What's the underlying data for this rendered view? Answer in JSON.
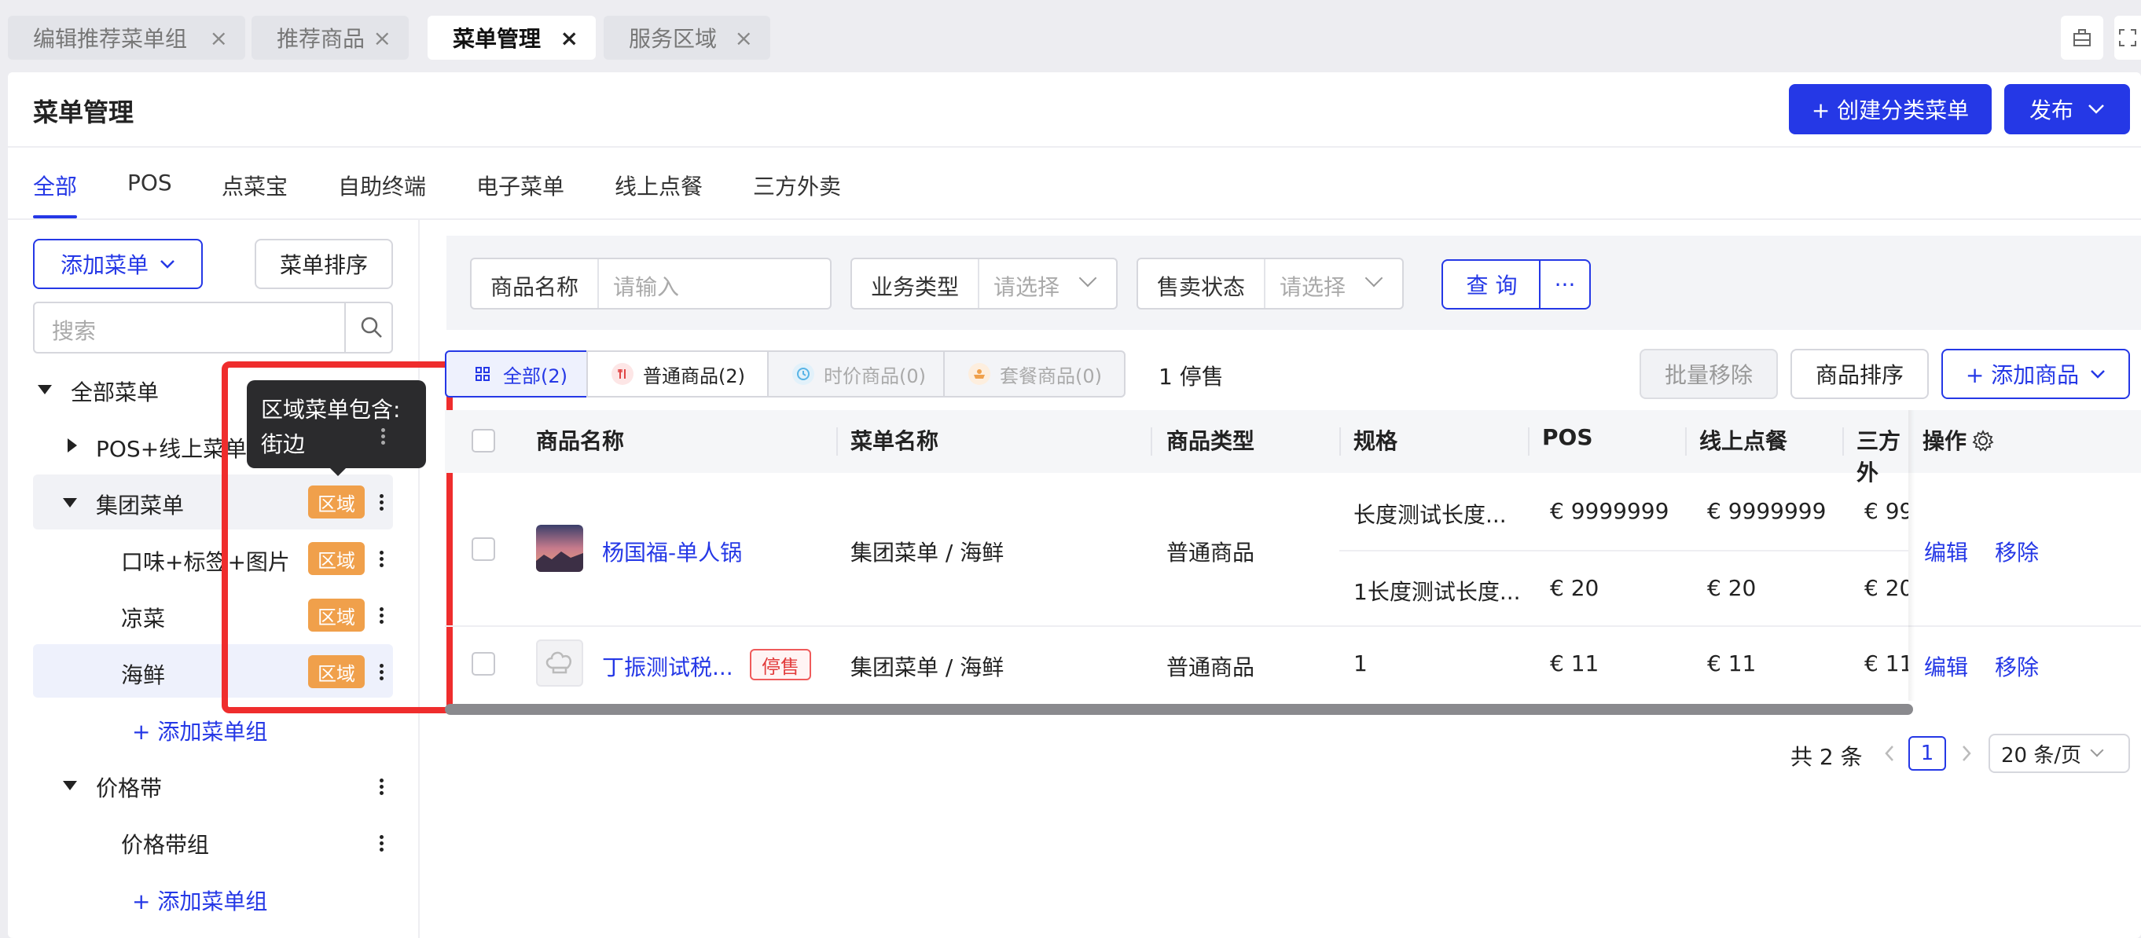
{
  "tabs": [
    {
      "label": "编辑推荐菜单组",
      "close": "×"
    },
    {
      "label": "推荐商品",
      "close": "×"
    },
    {
      "label": "菜单管理",
      "close": "×"
    },
    {
      "label": "服务区域",
      "close": "×"
    }
  ],
  "header": {
    "title": "菜单管理",
    "create_label": "+ 创建分类菜单",
    "publish_label": "发布"
  },
  "channels": [
    "全部",
    "POS",
    "点菜宝",
    "自助终端",
    "电子菜单",
    "线上点餐",
    "三方外卖"
  ],
  "sidebar": {
    "add_menu_label": "添加菜单",
    "sort_label": "菜单排序",
    "search_placeholder": "搜索",
    "tree": {
      "all_menus": "全部菜单",
      "pos_online": "POS+线上菜单",
      "group_menu": "集团菜单",
      "flavor": "口味+标签+图片",
      "cold": "凉菜",
      "seafood": "海鲜",
      "add_group_1": "+ 添加菜单组",
      "price_band": "价格带",
      "price_band_group": "价格带组",
      "add_group_2": "+ 添加菜单组"
    },
    "region_badge": "区域",
    "tooltip_line1": "区域菜单包含:",
    "tooltip_line2": "街边"
  },
  "filters": {
    "product_name_label": "商品名称",
    "product_name_placeholder": "请输入",
    "biz_type_label": "业务类型",
    "biz_type_placeholder": "请选择",
    "sale_status_label": "售卖状态",
    "sale_status_placeholder": "请选择",
    "query_label": "查 询",
    "more_label": "···"
  },
  "segments": [
    {
      "label": "全部(2)"
    },
    {
      "label": "普通商品(2)"
    },
    {
      "label": "时价商品(0)"
    },
    {
      "label": "套餐商品(0)"
    }
  ],
  "stopped_count": "1 停售",
  "actions": {
    "batch_remove": "批量移除",
    "product_sort": "商品排序",
    "add_product": "+ 添加商品"
  },
  "table": {
    "headers": [
      "商品名称",
      "菜单名称",
      "商品类型",
      "规格",
      "POS",
      "线上点餐",
      "三方外",
      "操作"
    ],
    "rows": [
      {
        "name": "杨国福-单人锅",
        "menu": "集团菜单 / 海鲜",
        "type": "普通商品",
        "specs": [
          {
            "spec": "长度测试长度...",
            "pos": "€  9999999",
            "online": "€  9999999",
            "third": "€  99"
          },
          {
            "spec": "1长度测试长度...",
            "pos": "€  20",
            "online": "€  20",
            "third": "€  20"
          }
        ],
        "edit": "编辑",
        "remove": "移除"
      },
      {
        "name": "丁振测试税...",
        "tag": "停售",
        "menu": "集团菜单 / 海鲜",
        "type": "普通商品",
        "specs": [
          {
            "spec": "1",
            "pos": "€  11",
            "online": "€  11",
            "third": "€  11"
          }
        ],
        "edit": "编辑",
        "remove": "移除"
      }
    ]
  },
  "pagination": {
    "total": "共 2 条",
    "current": "1",
    "page_size": "20 条/页"
  },
  "colors": {
    "primary": "#2538e6",
    "region_badge": "#f0a04b",
    "annotation_red": "#ef2d2d",
    "stop_red": "#e23c3c"
  }
}
